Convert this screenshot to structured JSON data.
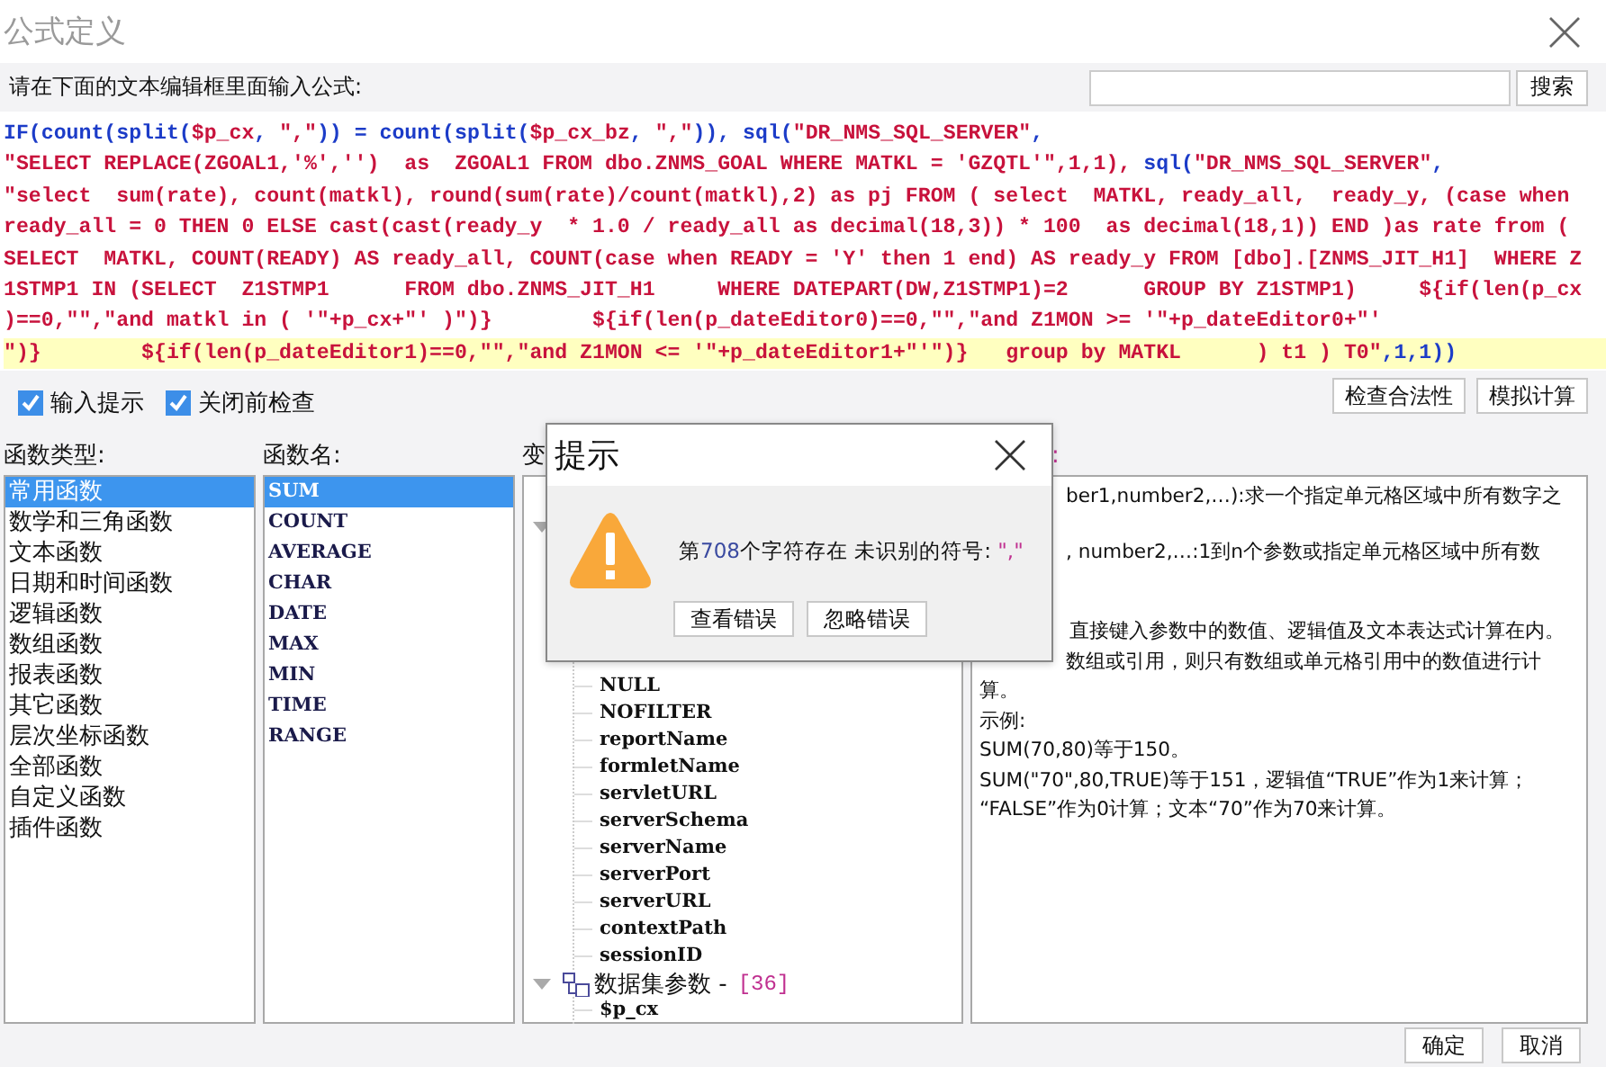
{
  "window": {
    "title": "公式定义"
  },
  "prompt": {
    "label": "请在下面的文本编辑框里面输入公式:",
    "search_button": "搜索"
  },
  "editor": {
    "lines": [
      {
        "current": false,
        "segments": [
          {
            "kind": "func",
            "text": "IF(count(split("
          },
          {
            "kind": "str",
            "text": "$p_cx"
          },
          {
            "kind": "func",
            "text": ", "
          },
          {
            "kind": "str",
            "text": "\",\""
          },
          {
            "kind": "func",
            "text": ")) = count(split("
          },
          {
            "kind": "str",
            "text": "$p_cx_bz"
          },
          {
            "kind": "func",
            "text": ", "
          },
          {
            "kind": "str",
            "text": "\",\""
          },
          {
            "kind": "func",
            "text": ")), sql("
          },
          {
            "kind": "str",
            "text": "\"DR_NMS_SQL_SERVER\""
          },
          {
            "kind": "func",
            "text": ","
          }
        ]
      },
      {
        "current": false,
        "segments": [
          {
            "kind": "str",
            "text": "\"SELECT REPLACE(ZGOAL1,'%','')  as  ZGOAL1 FROM dbo.ZNMS_GOAL WHERE MATKL = 'GZQTL'\",1,1), "
          },
          {
            "kind": "func",
            "text": "sql("
          },
          {
            "kind": "str",
            "text": "\"DR_NMS_SQL_SERVER\""
          },
          {
            "kind": "func",
            "text": ","
          }
        ]
      },
      {
        "current": false,
        "segments": [
          {
            "kind": "str",
            "text": "\"select  sum(rate), count(matkl), round(sum(rate)/count(matkl),2) as pj FROM ( select  MATKL, ready_all,  ready_y, (case when"
          }
        ]
      },
      {
        "current": false,
        "segments": [
          {
            "kind": "str",
            "text": "ready_all = 0 THEN 0 ELSE cast(cast(ready_y  * 1.0 / ready_all as decimal(18,3)) * 100  as decimal(18,1)) END )as rate from ("
          }
        ]
      },
      {
        "current": false,
        "segments": [
          {
            "kind": "str",
            "text": "SELECT  MATKL, COUNT(READY) AS ready_all, COUNT(case when READY = 'Y' then 1 end) AS ready_y FROM [dbo].[ZNMS_JIT_H1]  WHERE Z"
          }
        ]
      },
      {
        "current": false,
        "segments": [
          {
            "kind": "str",
            "text": "1STMP1 IN (SELECT  Z1STMP1      FROM dbo.ZNMS_JIT_H1     WHERE DATEPART(DW,Z1STMP1)=2      GROUP BY Z1STMP1)     ${if(len(p_cx"
          }
        ]
      },
      {
        "current": false,
        "segments": [
          {
            "kind": "str",
            "text": ")==0,\"\",\"and matkl in ( '\"+p_cx+\"' )\")}        ${if(len(p_dateEditor0)==0,\"\",\"and Z1MON >= '\"+p_dateEditor0+\"'"
          }
        ]
      },
      {
        "current": true,
        "segments": [
          {
            "kind": "str",
            "text": "\")}        ${if(len(p_dateEditor1)==0,\"\",\"and Z1MON <= '\"+p_dateEditor1+\"'\")}   group by MATKL      ) t1 ) T0\""
          },
          {
            "kind": "func",
            "text": ",1,1))"
          }
        ]
      }
    ]
  },
  "options": [
    {
      "label": "输入提示",
      "checked": true
    },
    {
      "label": "关闭前检查",
      "checked": true
    }
  ],
  "actions": [
    "检查合法性",
    "模拟计算"
  ],
  "column_labels": [
    "函数类型:",
    "函数名:",
    "变",
    ":"
  ],
  "function_types": [
    {
      "label": "常用函数",
      "selected": true
    },
    {
      "label": "数学和三角函数",
      "selected": false
    },
    {
      "label": "文本函数",
      "selected": false
    },
    {
      "label": "日期和时间函数",
      "selected": false
    },
    {
      "label": "逻辑函数",
      "selected": false
    },
    {
      "label": "数组函数",
      "selected": false
    },
    {
      "label": "报表函数",
      "selected": false
    },
    {
      "label": "其它函数",
      "selected": false
    },
    {
      "label": "层次坐标函数",
      "selected": false
    },
    {
      "label": "全部函数",
      "selected": false
    },
    {
      "label": "自定义函数",
      "selected": false
    },
    {
      "label": "插件函数",
      "selected": false
    }
  ],
  "function_names": [
    {
      "label": "SUM",
      "selected": true
    },
    {
      "label": "COUNT",
      "selected": false
    },
    {
      "label": "AVERAGE",
      "selected": false
    },
    {
      "label": "CHAR",
      "selected": false
    },
    {
      "label": "DATE",
      "selected": false
    },
    {
      "label": "MAX",
      "selected": false
    },
    {
      "label": "MIN",
      "selected": false
    },
    {
      "label": "TIME",
      "selected": false
    },
    {
      "label": "RANGE",
      "selected": false
    }
  ],
  "tree": [
    {
      "expanded": true,
      "children": [
        {
          "label": "NULL"
        },
        {
          "label": "NOFILTER"
        },
        {
          "label": "reportName"
        },
        {
          "label": "formletName"
        },
        {
          "label": "servletURL"
        },
        {
          "label": "serverSchema"
        },
        {
          "label": "serverName"
        },
        {
          "label": "serverPort"
        },
        {
          "label": "serverURL"
        },
        {
          "label": "contextPath"
        },
        {
          "label": "sessionID"
        }
      ]
    },
    {
      "label": "数据集参数 -",
      "count": "[36]",
      "expanded": true,
      "children": [
        {
          "label": "$p_cx"
        }
      ]
    }
  ],
  "description": [
    {
      "kind": "clipped",
      "text": "ber1,number2,…):求一个指定单元格区域中所有数字之"
    },
    {
      "kind": "clipped",
      "text": ", number2,…:1到n个参数或指定单元格区域中所有数"
    },
    {
      "kind": "clipped",
      "text": "直接键入参数中的数值、逻辑值及文本表达式计算在内。"
    },
    {
      "kind": "clipped",
      "text": "数组或引用，则只有数组或单元格引用中的数值进行计"
    },
    {
      "kind": "full",
      "text": "算。"
    },
    {
      "kind": "full",
      "text": "示例:"
    },
    {
      "kind": "full",
      "text": "SUM(70,80)等于150。"
    },
    {
      "kind": "full",
      "text": "SUM(\"70\",80,TRUE)等于151，逻辑值“TRUE”作为1来计算；"
    },
    {
      "kind": "full",
      "text": "“FALSE”作为0计算；文本“70”作为70来计算。"
    }
  ],
  "footer_buttons": [
    "确定",
    "取消"
  ],
  "dialog": {
    "title": "提示",
    "message": [
      {
        "kind": "text",
        "text": "第"
      },
      {
        "kind": "number",
        "text": "708"
      },
      {
        "kind": "text",
        "text": "个字符存在 未识别的符号: "
      },
      {
        "kind": "symbol",
        "text": "\",\""
      }
    ],
    "buttons": [
      "查看错误",
      "忽略错误"
    ]
  }
}
